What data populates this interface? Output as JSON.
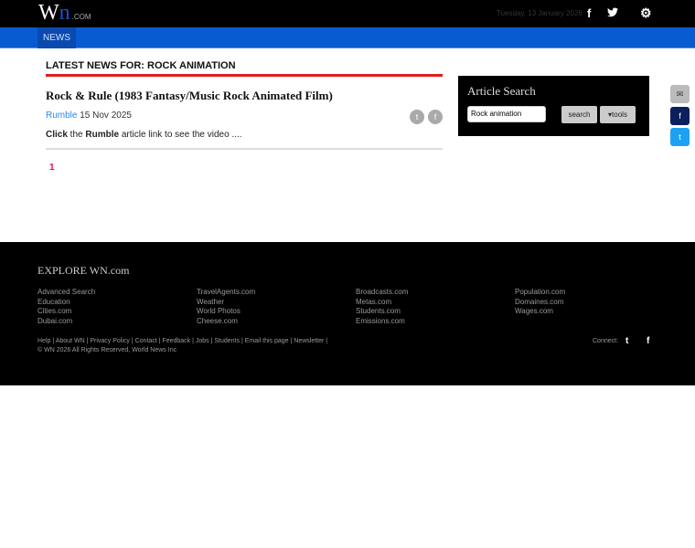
{
  "header": {
    "logo_w": "W",
    "logo_n": "n",
    "logo_com": ".COM",
    "date": "Tuesday, 13 January 2026",
    "facebook_icon": "f",
    "twitter_icon": "t",
    "settings_icon": "⚙"
  },
  "nav": {
    "news": "NEWS"
  },
  "main": {
    "heading": "LATEST NEWS FOR: ROCK ANIMATION",
    "article": {
      "title": "Rock & Rule (1983 Fantasy/Music Rock Animated Film)",
      "source": "Rumble",
      "date": "15 Nov 2025",
      "desc_1": "Click",
      "desc_2": " the ",
      "desc_3": "Rumble",
      "desc_4": " article link to see the video ...."
    },
    "page": "1"
  },
  "search": {
    "title": "Article Search",
    "value": "Rock animation",
    "search": "search",
    "tools": "▾tools"
  },
  "footer": {
    "explore": "EXPLORE WN.com",
    "columns": [
      [
        "Advanced Search",
        "Education",
        "Cities.com",
        "Dubai.com"
      ],
      [
        "TravelAgents.com",
        "Weather",
        "World Photos",
        "Cheese.com"
      ],
      [
        "Broadcasts.com",
        "Metas.com",
        "Students.com",
        "Emissions.com"
      ],
      [
        "Population.com",
        "Domaines.com",
        "Wages.com"
      ]
    ],
    "links": "Help | About WN | Privacy Policy | Contact | Feedback | Jobs | Students | Email this page | Newsletter |",
    "copyright": "© WN 2026 All Rights Reserved, World News Inc",
    "connect": "Connect:"
  }
}
